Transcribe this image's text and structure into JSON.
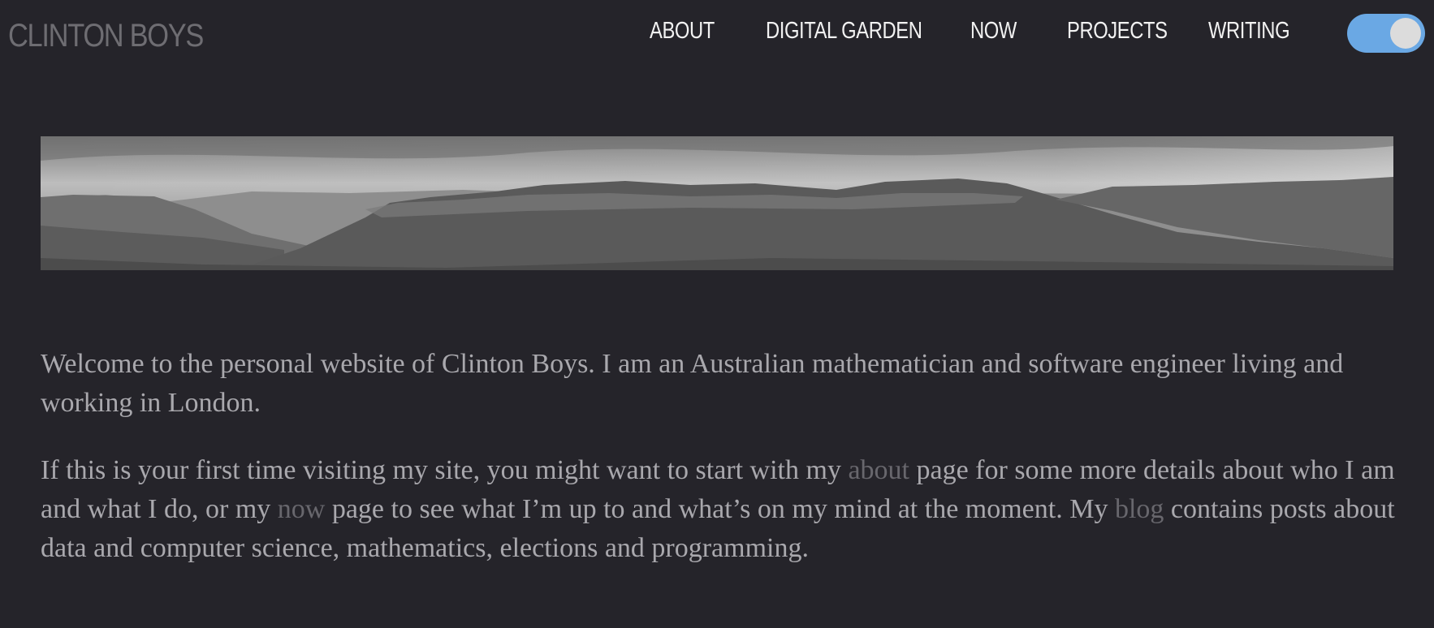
{
  "header": {
    "site_title": "CLINTON BOYS",
    "nav": [
      "ABOUT",
      "DIGITAL GARDEN",
      "NOW",
      "PROJECTS",
      "WRITING"
    ],
    "theme_toggle": {
      "state": "on",
      "color": "#6aa8e4"
    }
  },
  "hero": {
    "icon": "mountain-landscape-banner"
  },
  "intro": {
    "paragraph1": "Welcome to the personal website of Clinton Boys. I am an Australian mathematician and software engineer living and working in London.",
    "p2_before_about": "If this is your first time visiting my site, you might want to start with my",
    "p2_about_link": "about",
    "p2_after_about": "page for some more details about who I am and what I do, or my",
    "p2_now_link": "now",
    "p2_after_now": "page to see what I’m up to and what’s on my mind at the moment. My",
    "p2_blog_link": "blog",
    "p2_after_blog": "contains posts about data and computer science, mathematics, elections and programming."
  },
  "colors": {
    "background": "#25242a",
    "text": "#a9a8ad",
    "link": "#68676d",
    "nav_text": "#f2f2f2",
    "title": "#6e6d72"
  }
}
